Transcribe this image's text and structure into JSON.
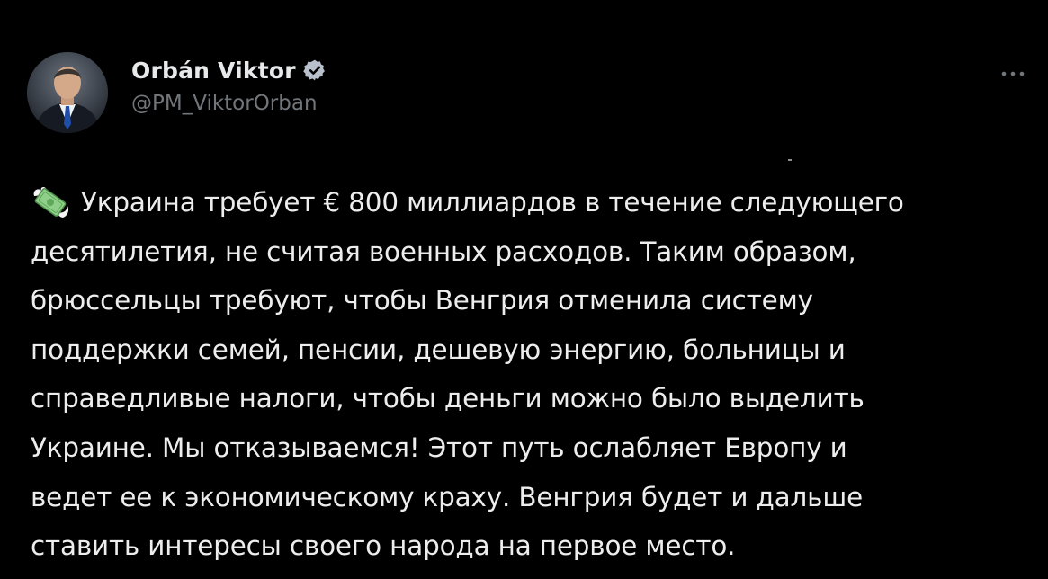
{
  "tweet": {
    "author": {
      "display_name": "Orbán Viktor",
      "handle": "@PM_ViktorOrban",
      "verified": true,
      "avatar": "profile-photo-man-in-suit"
    },
    "more_icon": "more-options-icon",
    "body": {
      "emoji": "money-with-wings-icon",
      "lines": [
        "Украина требует € 800 миллиардов в течение следующего",
        "десятилетия, не считая военных расходов. Таким образом,",
        "брюссельцы требуют, чтобы Венгрия отменила систему",
        "поддержки семей, пенсии, дешевую энергию, больницы и",
        "справедливые налоги, чтобы деньги можно было выделить",
        "Украине. Мы отказываемся! Этот путь ослабляет Европу и",
        "ведет ее к экономическому краху. Венгрия будет и дальше",
        "ставить интересы своего народа на первое место."
      ]
    },
    "colors": {
      "background": "#000000",
      "text": "#e7e9ea",
      "secondary_text": "#71767b",
      "verified_badge": "#b8c0cc"
    }
  }
}
